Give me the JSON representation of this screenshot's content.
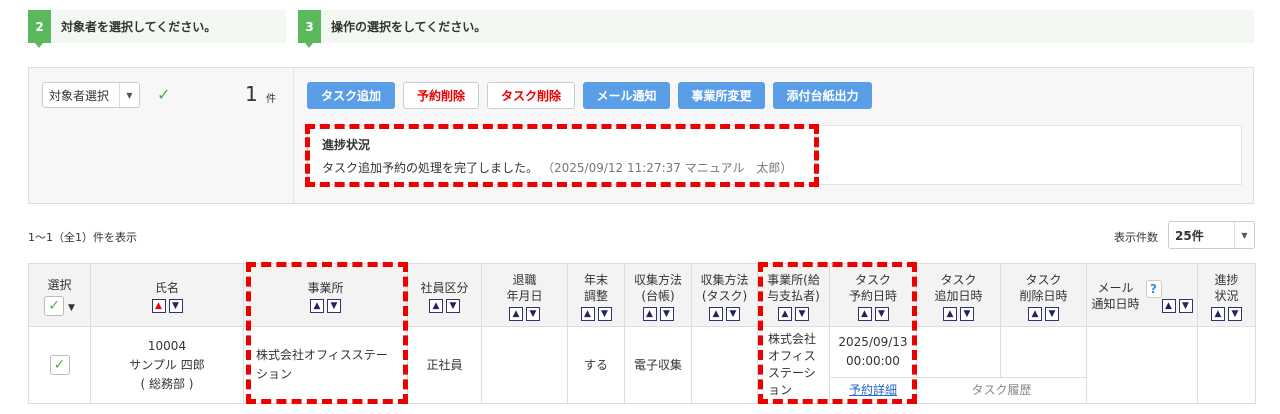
{
  "steps": [
    {
      "num": "2",
      "label": "対象者を選択してください。"
    },
    {
      "num": "3",
      "label": "操作の選択をしてください。"
    }
  ],
  "panel": {
    "selector": "対象者選択",
    "count": "1",
    "count_unit": "件",
    "buttons": [
      "タスク追加",
      "予約削除",
      "タスク削除",
      "メール通知",
      "事業所変更",
      "添付台紙出力"
    ],
    "status_title": "進捗状況",
    "status_message": "タスク追加予約の処理を完了しました。",
    "status_meta": "（2025/09/12 11:27:37 マニュアル　太郎）"
  },
  "list": {
    "summary": "1〜1（全1）件を表示",
    "page_size_label": "表示件数",
    "page_size": "25件"
  },
  "table": {
    "headers": [
      "選択",
      "氏名",
      "事業所",
      "社員区分",
      "退職\n年月日",
      "年末\n調整",
      "収集方法\n(台帳)",
      "収集方法\n(タスク)",
      "事業所(給\n与支払者)",
      "タスク\n予約日時",
      "タスク\n追加日時",
      "タスク\n削除日時",
      "メール\n通知日時",
      "進捗\n状況"
    ],
    "row": {
      "id": "10004",
      "name": "サンプル 四郎",
      "dept": "( 総務部 )",
      "office": "株式会社オフィスステーション",
      "type": "正社員",
      "retire": "",
      "yearend": "する",
      "method_ledger": "電子収集",
      "method_task": "",
      "payer": "株式会社オフィスステーション",
      "reserve_date": "2025/09/13",
      "reserve_time": "00:00:00",
      "reserve_link": "予約詳細",
      "history_link": "タスク履歴"
    }
  },
  "colors": {
    "accent": "#5b9ee8",
    "step": "#5cb85c",
    "annotation": "#e00000"
  }
}
